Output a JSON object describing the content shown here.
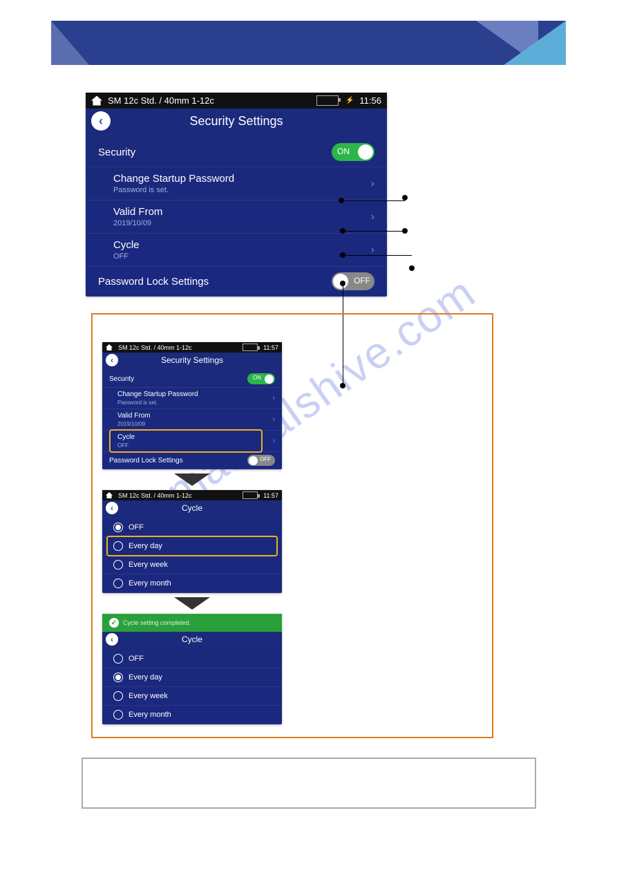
{
  "watermark": "manualshive.com",
  "statusbar": {
    "device_mode": "SM 12c Std. / 40mm 1-12c",
    "time_main": "11:56",
    "time_small": "11:57"
  },
  "main_screen": {
    "title": "Security Settings",
    "rows": {
      "security": {
        "label": "Security",
        "toggle": "ON"
      },
      "change_pw": {
        "label": "Change Startup Password",
        "sub": "Password is set."
      },
      "valid_from": {
        "label": "Valid From",
        "sub": "2019/10/09"
      },
      "cycle": {
        "label": "Cycle",
        "sub": "OFF"
      },
      "pw_lock": {
        "label": "Password Lock Settings",
        "toggle": "OFF"
      }
    }
  },
  "step1": {
    "title": "Security Settings",
    "rows": {
      "security": {
        "label": "Security",
        "toggle": "ON"
      },
      "change_pw": {
        "label": "Change Startup Password",
        "sub": "Password is set."
      },
      "valid_from": {
        "label": "Valid From",
        "sub": "2019/10/09"
      },
      "cycle": {
        "label": "Cycle",
        "sub": "OFF"
      },
      "pw_lock": {
        "label": "Password Lock Settings",
        "toggle": "OFF"
      }
    }
  },
  "step2": {
    "title": "Cycle",
    "options": [
      "OFF",
      "Every day",
      "Every week",
      "Every month"
    ],
    "selected": "OFF",
    "highlighted": "Every day"
  },
  "step3": {
    "title": "Cycle",
    "toast": "Cycle setting completed.",
    "options": [
      "OFF",
      "Every day",
      "Every week",
      "Every month"
    ],
    "selected": "Every day"
  }
}
